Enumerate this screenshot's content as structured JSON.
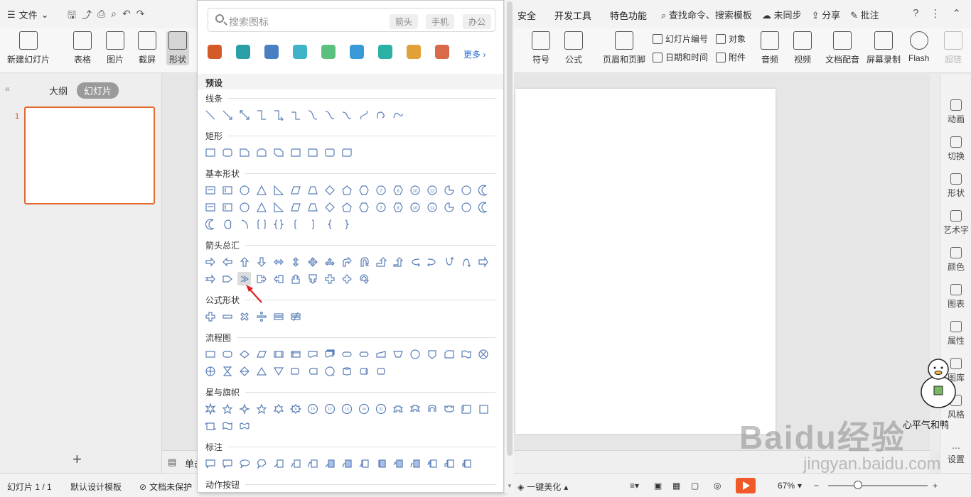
{
  "menubar": {
    "file_label": "文件",
    "tabs": [
      "安全",
      "开发工具",
      "特色功能"
    ],
    "search_label": "查找命令、搜索模板",
    "sync_label": "未同步",
    "share_label": "分享",
    "comment_label": "批注"
  },
  "ribbon": {
    "new_slide": "新建幻灯片",
    "table": "表格",
    "image": "图片",
    "screenshot": "截屏",
    "shape": "形状",
    "symbol": "符号",
    "formula": "公式",
    "header_footer": "页眉和页脚",
    "slide_number": "幻灯片编号",
    "object": "对象",
    "date_time": "日期和时间",
    "attachment": "附件",
    "audio": "音频",
    "video": "视频",
    "doc_voice": "文档配音",
    "screen_record": "屏幕录制",
    "flash": "Flash",
    "super": "超链"
  },
  "left_panel": {
    "outline_tab": "大纲",
    "slides_tab": "幻灯片",
    "slide_number": "1"
  },
  "notes": {
    "label": "单击此处添加备注"
  },
  "right_sidebar": [
    "动画",
    "切换",
    "形状",
    "艺术字",
    "颜色",
    "图表",
    "属性",
    "图库",
    "风格",
    "设置"
  ],
  "statusbar": {
    "slide_info": "幻灯片 1 / 1",
    "template": "默认设计模板",
    "doc_protect": "文档未保护",
    "beautify": "一键美化",
    "zoom": "67%"
  },
  "shapes_panel": {
    "search_placeholder": "搜索图标",
    "tags": [
      "箭头",
      "手机",
      "办公"
    ],
    "more_label": "更多",
    "preset_label": "预设",
    "categories": {
      "lines": "线条",
      "rect": "矩形",
      "basic": "基本形状",
      "arrows": "箭头总汇",
      "formula": "公式形状",
      "flowchart": "流程图",
      "stars": "星与旗帜",
      "callouts": "标注",
      "action": "动作按钮"
    }
  },
  "watermark": {
    "baidu": "Baidu经验",
    "jingyan": "jingyan.baidu.com",
    "author": "心平气和鸭"
  }
}
